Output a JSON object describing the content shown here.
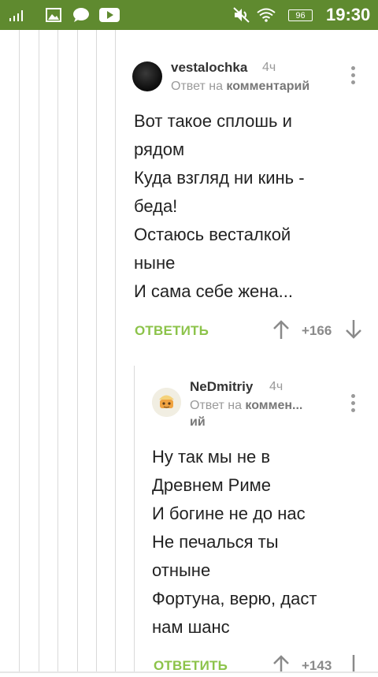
{
  "status_bar": {
    "battery": "96",
    "time": "19:30",
    "icons": [
      "signal-icon",
      "image-icon",
      "chat-bubble-icon",
      "youtube-icon",
      "mute-icon",
      "wifi-icon",
      "battery-icon"
    ]
  },
  "comments": [
    {
      "author": "vestalochka",
      "time_ago": "4ч",
      "reply_prefix": "Ответ на",
      "reply_target": "комментарий",
      "body": [
        "Вот такое сплошь и",
        "рядом",
        "Куда взгляд ни кинь -",
        "беда!",
        "Остаюсь весталкой",
        "ныне",
        "И сама себе жена..."
      ],
      "reply_button": "ОТВЕТИТЬ",
      "score": "+166"
    },
    {
      "author": "NeDmitriy",
      "time_ago": "4ч",
      "reply_prefix": "Ответ на",
      "reply_target_line1": "коммен...",
      "reply_target_line2": "ий",
      "body": [
        "Ну так мы не в",
        "Древнем Риме",
        "И богине не до нас",
        "Не печалься ты",
        "отныне",
        "Фортуна, верю, даст",
        "нам шанс"
      ],
      "reply_button": "ОТВЕТИТЬ",
      "score": "+143"
    }
  ],
  "colors": {
    "status_bar": "#5f8a2f",
    "accent_green": "#8cc34a",
    "thread_line": "#d9d9d9"
  }
}
